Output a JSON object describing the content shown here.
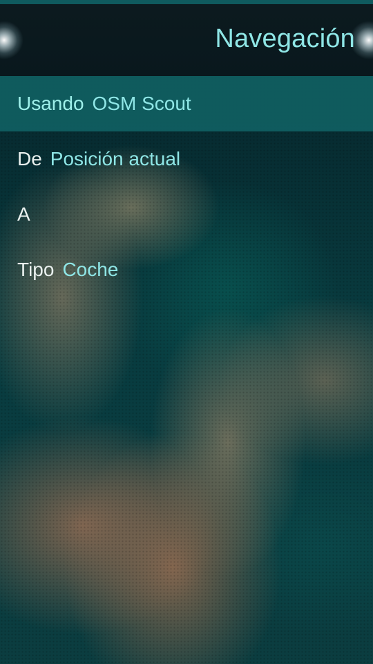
{
  "header": {
    "title": "Navegación"
  },
  "menu": {
    "provider": {
      "label": "Usando",
      "value": "OSM Scout"
    },
    "from": {
      "label": "De",
      "value": "Posición actual"
    },
    "to": {
      "label": "A",
      "value": ""
    },
    "type": {
      "label": "Tipo",
      "value": "Coche"
    }
  },
  "colors": {
    "accent": "#8fe6e6",
    "highlight_row": "#0f6062",
    "header_bg": "#0c1a1f",
    "text": "#e9f0ee"
  }
}
